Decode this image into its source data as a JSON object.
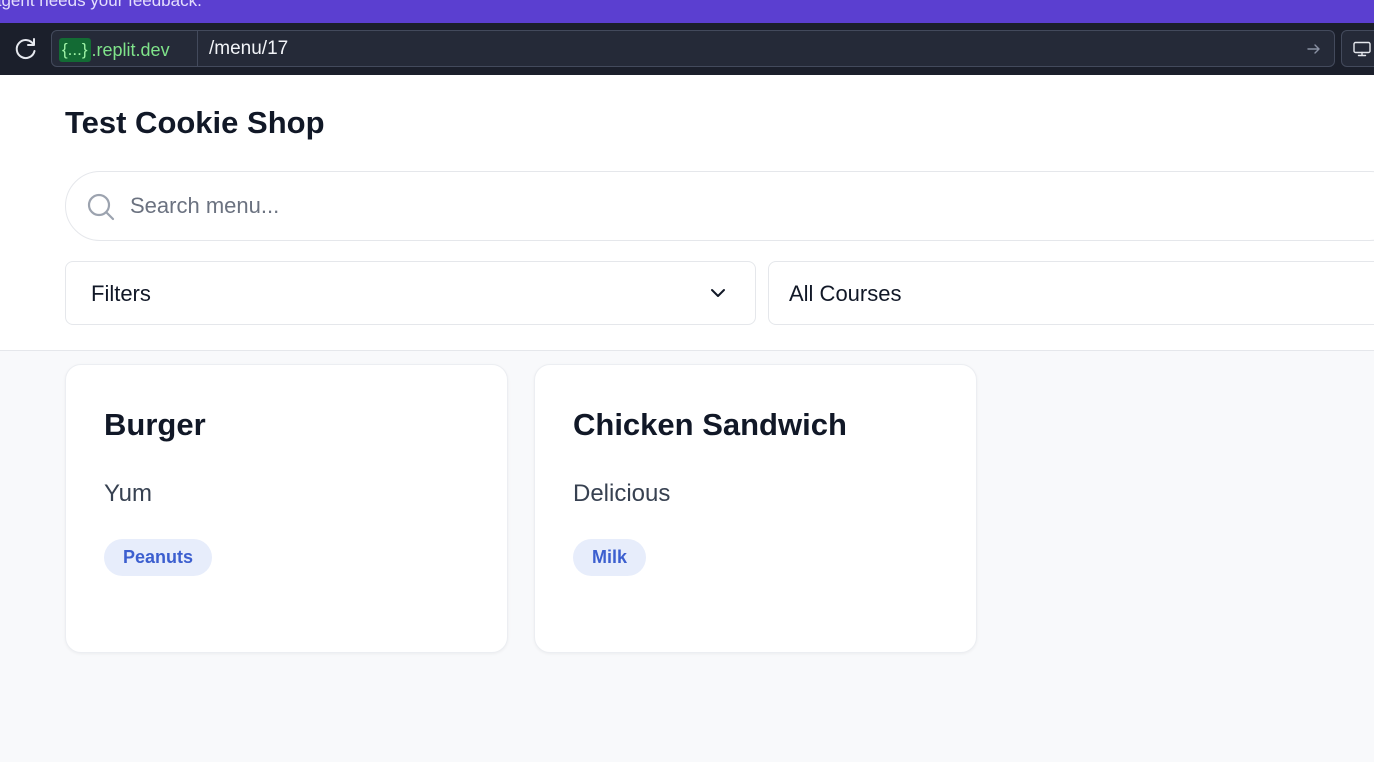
{
  "banner": {
    "text": "agent needs your feedback."
  },
  "browser": {
    "host_badge": "{...}",
    "host_domain": ".replit.dev",
    "path": "/menu/17",
    "reload_icon": "reload-icon",
    "go_icon": "arrow-right-icon",
    "screen_icon": "monitor-icon"
  },
  "shop": {
    "title": "Test Cookie Shop",
    "search": {
      "placeholder": "Search menu...",
      "value": "",
      "icon": "search-icon"
    },
    "filters": {
      "label": "Filters",
      "icon": "chevron-down-icon"
    },
    "course_select": {
      "selected": "All Courses"
    }
  },
  "menu_items": [
    {
      "name": "Burger",
      "description": "Yum",
      "tags": [
        "Peanuts"
      ]
    },
    {
      "name": "Chicken Sandwich",
      "description": "Delicious",
      "tags": [
        "Milk"
      ]
    }
  ],
  "colors": {
    "banner": "#5b3fd0",
    "toolbar": "#1b1f2b",
    "tag_bg": "#e7edfb",
    "tag_text": "#3c5fcf",
    "page_bg": "#f8f9fb"
  }
}
